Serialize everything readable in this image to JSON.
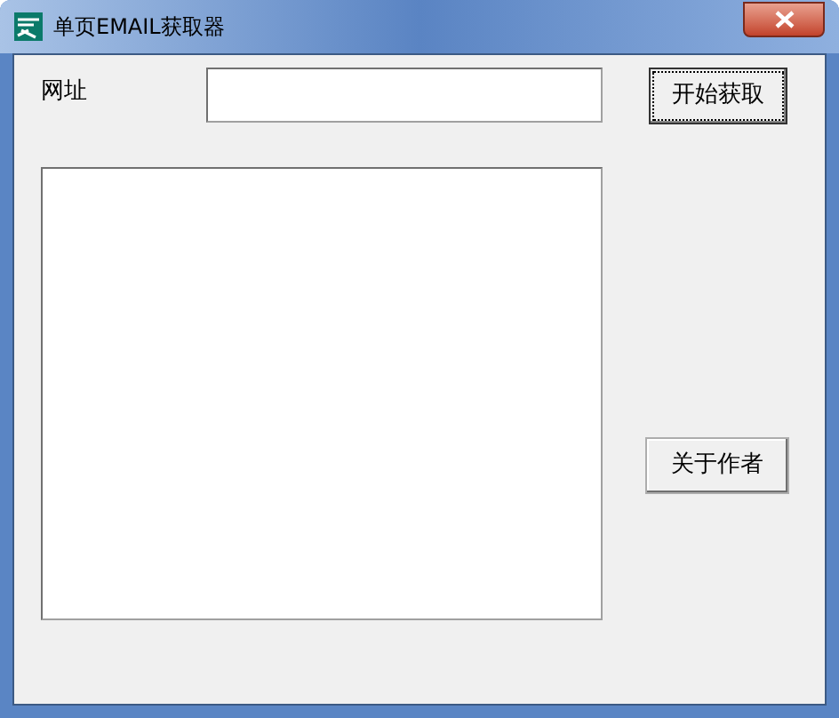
{
  "window": {
    "title": "单页EMAIL获取器"
  },
  "url_label": "网址",
  "buttons": [
    {
      "label": "开始获取",
      "focused": true
    },
    {
      "label": "关于作者",
      "focused": false
    }
  ]
}
